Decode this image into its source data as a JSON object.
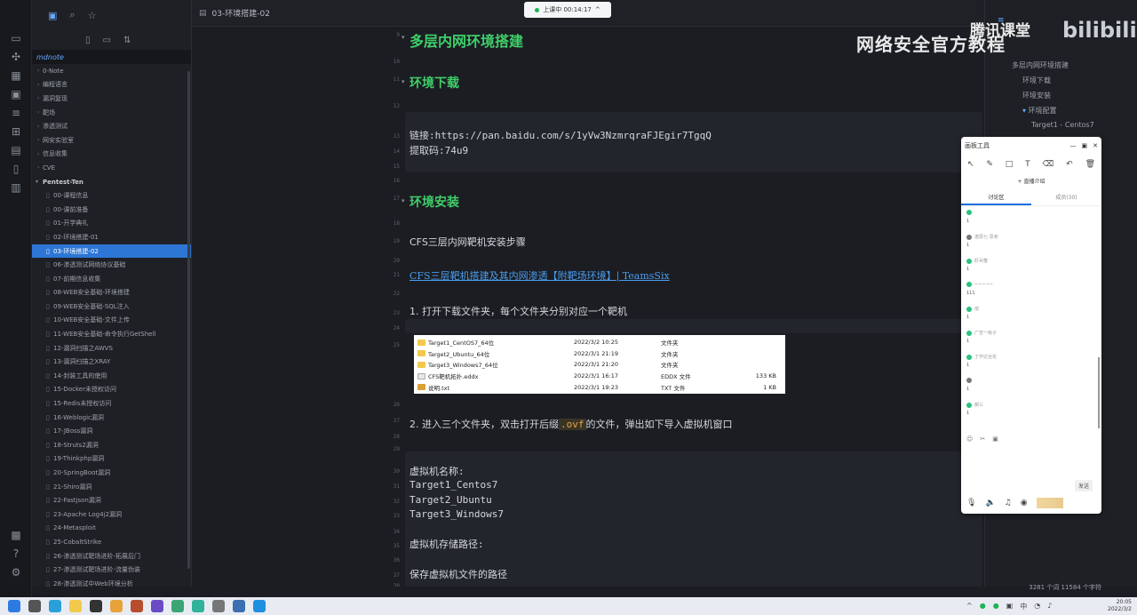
{
  "recording": {
    "label": "上课中 00:14:17",
    "chevron": "^"
  },
  "watermark": {
    "text": "网络安全官方教程",
    "brand": "腾讯课堂",
    "site": "bilibili"
  },
  "tree": {
    "vault": "mdnote",
    "folders": [
      "0-Note",
      "编程语言",
      "漏洞复现",
      "靶场",
      "渗透测试",
      "网安实验室",
      "信息收集",
      "CVE"
    ],
    "section": "Pentest-Ten",
    "files": [
      "00-课程信息",
      "00-课前准备",
      "01-开学典礼",
      "02-环境搭建-01",
      "03-环境搭建-02",
      "06-渗透测试网络协议基础",
      "07-前期信息收集",
      "08-WEB安全基础-环境搭建",
      "09-WEB安全基础-SQL注入",
      "10-WEB安全基础-文件上传",
      "11-WEB安全基础-命令执行GetShell",
      "12-漏洞扫描之AWVS",
      "13-漏洞扫描之XRAY",
      "14-封装工具的使用",
      "15-Docker未授权访问",
      "15-Redis未授权访问",
      "16-Weblogic漏洞",
      "17-JBoss漏洞",
      "18-Struts2漏洞",
      "19-Thinkphp漏洞",
      "20-SpringBoot漏洞",
      "21-Shiro漏洞",
      "22-Fastjson漏洞",
      "23-Apache Log4j2漏洞",
      "24-Metasploit",
      "25-CobaltStrike",
      "26-渗透测试靶场进阶-拓展后门",
      "27-渗透测试靶场进阶-流量伪装",
      "28-渗透测试中Web环境分析"
    ],
    "active_index": 4
  },
  "editor": {
    "tab_title": "03-环境搭建-02",
    "h_top": "多层内网环境搭建",
    "h_download": "环境下载",
    "download_link": "链接:https://pan.baidu.com/s/1yVw3NzmrqraFJEgir7TgqQ",
    "download_code": "提取码:74u9",
    "h_install": "环境安装",
    "install_title": "CFS三层内网靶机安装步骤",
    "install_link": "CFS三层靶机搭建及其内网渗透【附靶场环境】| TeamsSix",
    "step1": "1. 打开下载文件夹，每个文件夹分别对应一个靶机",
    "step2_pre": "2. 进入三个文件夹，双击打开后缀",
    "step2_code": ".ovf",
    "step2_post": "的文件，弹出如下导入虚拟机窗口",
    "vm_name_label": "虚拟机名称:",
    "vm_names": [
      "Target1_Centos7",
      "Target2_Ubuntu",
      "Target3_Windows7"
    ],
    "vm_path_label": "虚拟机存储路径:",
    "vm_path_value": "保存虚拟机文件的路径",
    "line_numbers": [
      "9",
      "10",
      "11",
      "12",
      "13",
      "14",
      "15",
      "16",
      "17",
      "18",
      "19",
      "20",
      "21",
      "22",
      "23",
      "24",
      "25",
      "26",
      "27",
      "28",
      "29",
      "30",
      "31",
      "32",
      "33",
      "34",
      "35",
      "36",
      "37",
      "38"
    ]
  },
  "fileshot": {
    "rows": [
      {
        "name": "Target1_CentOS7_64位",
        "date": "2022/3/2 10:25",
        "type": "文件夹",
        "size": ""
      },
      {
        "name": "Target2_Ubuntu_64位",
        "date": "2022/3/1 21:19",
        "type": "文件夹",
        "size": ""
      },
      {
        "name": "Target3_Windows7_64位",
        "date": "2022/3/1 21:20",
        "type": "文件夹",
        "size": ""
      },
      {
        "name": "CFS靶机拓扑.eddx",
        "date": "2022/3/1 16:17",
        "type": "EDDX 文件",
        "size": "133 KB"
      },
      {
        "name": "说明.txt",
        "date": "2022/3/1 19:23",
        "type": "TXT 文件",
        "size": "1 KB"
      }
    ]
  },
  "outline": {
    "items": [
      "多层内网环境搭建",
      "环境下载",
      "环境安装",
      "环境配置",
      "Target1 - Centos7"
    ]
  },
  "panel": {
    "title": "画板工具",
    "intro": "+ 直播介绍",
    "tab_discuss": "讨论区",
    "tab_members": "成员(30)",
    "messages": [
      {
        "name": "",
        "text": "1"
      },
      {
        "name": "诺思七·思考",
        "text": "1"
      },
      {
        "name": "虾兵蟹",
        "text": "1"
      },
      {
        "name": "~~~~~",
        "text": "111"
      },
      {
        "name": "琪",
        "text": "1"
      },
      {
        "name": "广告一级子",
        "text": "1"
      },
      {
        "name": "丁作达丝花",
        "text": "1"
      },
      {
        "name": "",
        "text": "1"
      },
      {
        "name": "朝三",
        "text": "1"
      }
    ],
    "send_label": "发送"
  },
  "status": {
    "text": "3281 个词   11584 个字符"
  },
  "clock": {
    "time": "20:05",
    "date": "2022/3/2"
  }
}
